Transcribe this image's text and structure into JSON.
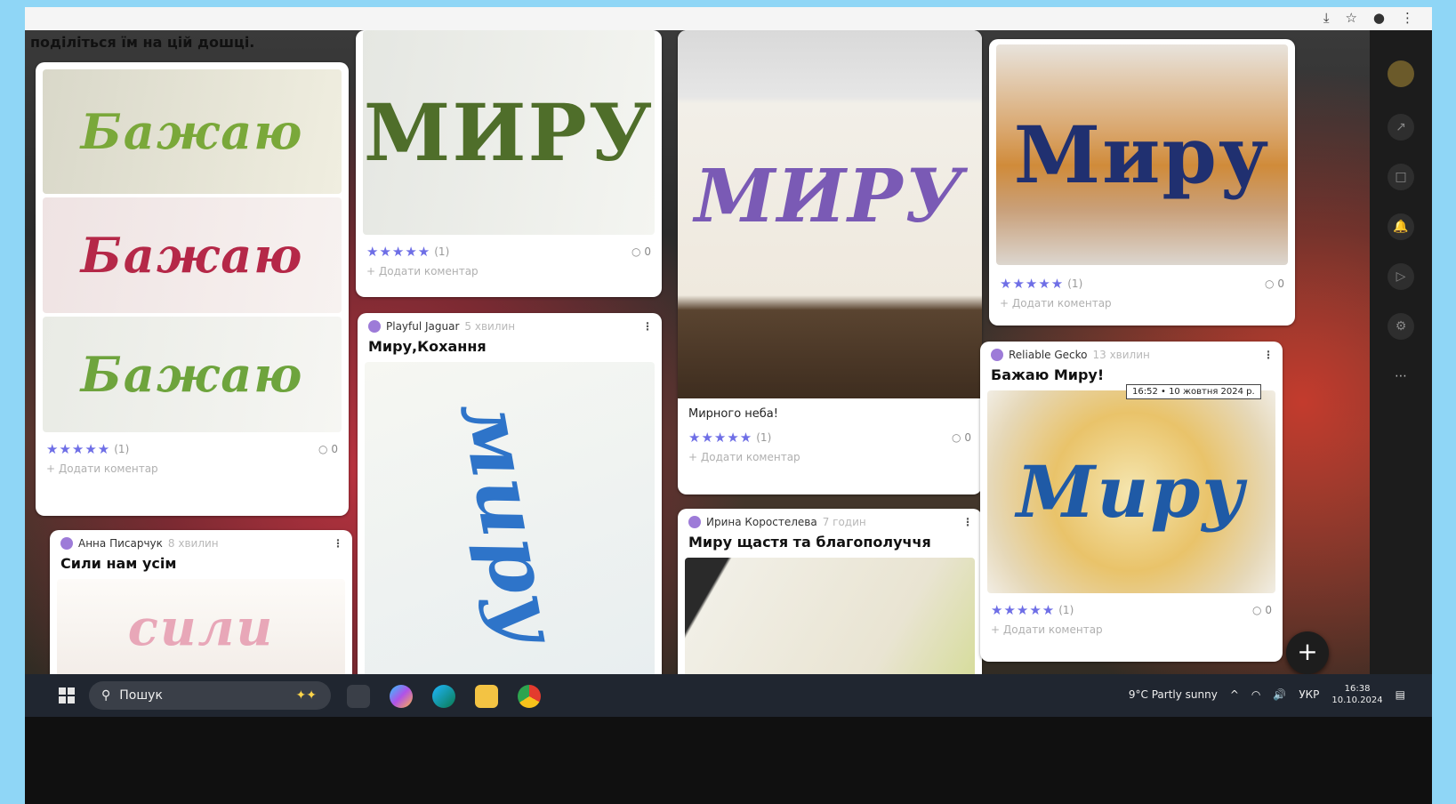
{
  "intro": "поділіться їм на цій дошці.",
  "cards": [
    {
      "id": "c1",
      "stars": "★★★★★",
      "count": "(1)",
      "comments": "0",
      "add": "+ Додати коментар",
      "art": "Бажаю"
    },
    {
      "id": "c2",
      "stars": "★★★★★",
      "count": "(1)",
      "comments": "0",
      "add": "+ Додати коментар",
      "art": "МИРУ"
    },
    {
      "id": "c3",
      "body": "Мирного неба!",
      "stars": "★★★★★",
      "count": "(1)",
      "comments": "0",
      "add": "+ Додати коментар",
      "art": "МИРУ"
    },
    {
      "id": "c4",
      "stars": "★★★★★",
      "count": "(1)",
      "comments": "0",
      "add": "+ Додати коментар",
      "art": "Миру"
    },
    {
      "id": "c5",
      "author": "Анна Писарчук",
      "ago": "8 хвилин",
      "title": "Сили нам усім",
      "art": "сили"
    },
    {
      "id": "c6",
      "author": "Playful Jaguar",
      "ago": "5 хвилин",
      "title": "Миру,Кохання",
      "art": "миру"
    },
    {
      "id": "c7",
      "author": "Ирина Коростелева",
      "ago": "7 годин",
      "title": "Миру щастя та благополуччя"
    },
    {
      "id": "c8",
      "author": "Reliable Gecko",
      "ago": "13 хвилин",
      "title": "Бажаю Миру!",
      "stars": "★★★★★",
      "count": "(1)",
      "comments": "0",
      "add": "+ Додати коментар",
      "art": "Миру"
    }
  ],
  "tooltip": "16:52 • 10 жовтня 2024 р.",
  "taskbar": {
    "search_label": "Пошук",
    "weather": "9°C Partly sunny",
    "lang": "УКР",
    "time": "16:38",
    "date": "10.10.2024"
  },
  "colors": {
    "accent": "#6e6ee6",
    "taskbar": "#202630",
    "frame": "#8fd6f6"
  }
}
